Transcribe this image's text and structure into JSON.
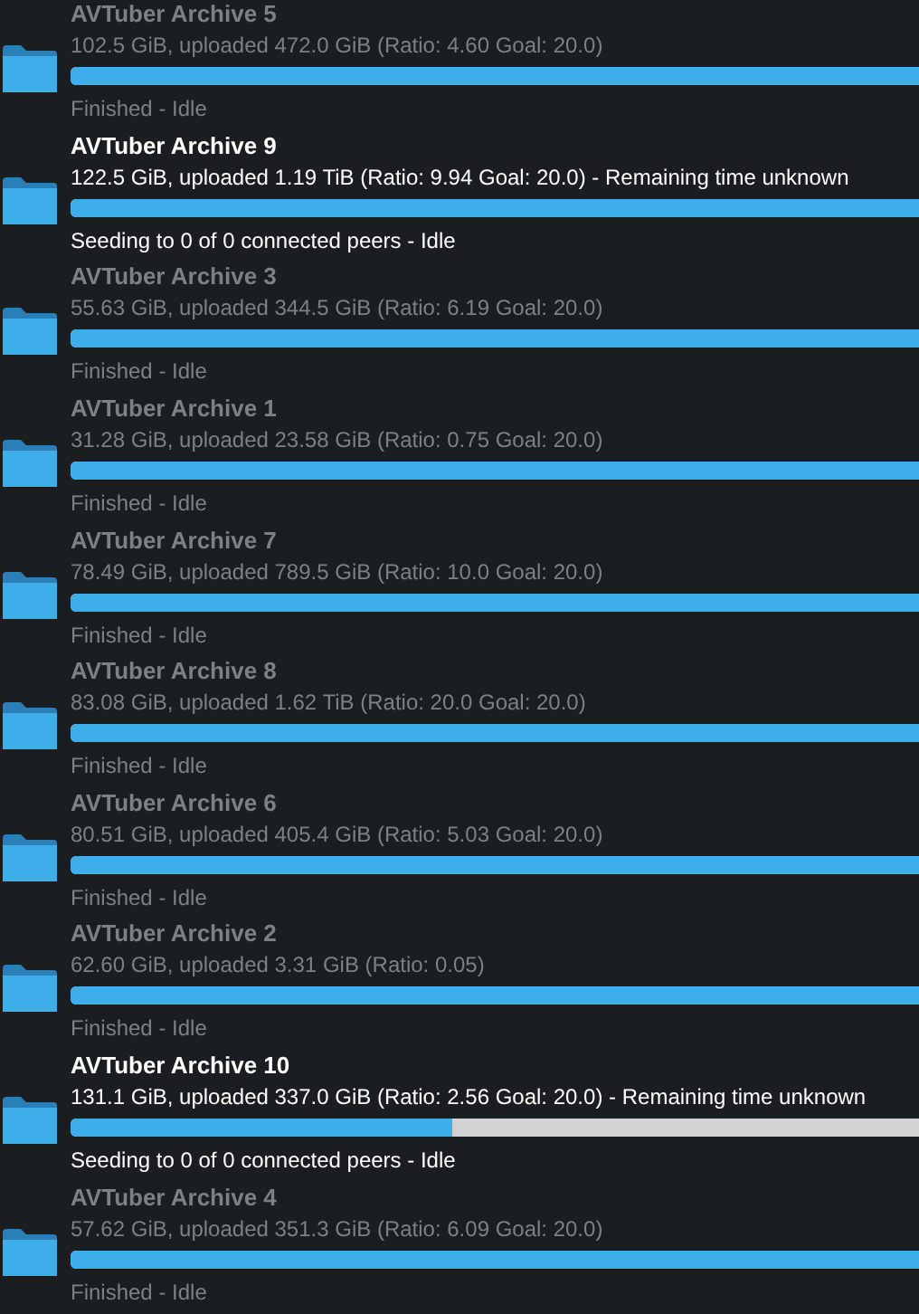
{
  "torrents": [
    {
      "name": "AVTuber Archive 5",
      "details": "102.5 GiB, uploaded 472.0 GiB (Ratio: 4.60 Goal: 20.0)",
      "level": 1,
      "status": "Finished - Idle",
      "active": false
    },
    {
      "name": "AVTuber Archive 9",
      "details": "122.5 GiB, uploaded 1.19 TiB (Ratio: 9.94 Goal: 20.0) - Remaining time unknown",
      "level": 1,
      "status": "Seeding to 0 of 0 connected peers - Idle",
      "active": true
    },
    {
      "name": "AVTuber Archive 3",
      "details": "55.63 GiB, uploaded 344.5 GiB (Ratio: 6.19 Goal: 20.0)",
      "level": 1,
      "status": "Finished - Idle",
      "active": false
    },
    {
      "name": "AVTuber Archive 1",
      "details": "31.28 GiB, uploaded 23.58 GiB (Ratio: 0.75 Goal: 20.0)",
      "level": 1,
      "status": "Finished - Idle",
      "active": false
    },
    {
      "name": "AVTuber Archive 7",
      "details": "78.49 GiB, uploaded 789.5 GiB (Ratio: 10.0 Goal: 20.0)",
      "level": 1,
      "status": "Finished - Idle",
      "active": false
    },
    {
      "name": "AVTuber Archive 8",
      "details": "83.08 GiB, uploaded 1.62 TiB (Ratio: 20.0 Goal: 20.0)",
      "level": 1,
      "status": "Finished - Idle",
      "active": false
    },
    {
      "name": "AVTuber Archive 6",
      "details": "80.51 GiB, uploaded 405.4 GiB (Ratio: 5.03 Goal: 20.0)",
      "level": 1,
      "status": "Finished - Idle",
      "active": false
    },
    {
      "name": "AVTuber Archive 2",
      "details": "62.60 GiB, uploaded 3.31 GiB (Ratio: 0.05)",
      "level": 1,
      "status": "Finished - Idle",
      "active": false
    },
    {
      "name": "AVTuber Archive 10",
      "details": "131.1 GiB, uploaded 337.0 GiB (Ratio: 2.56 Goal: 20.0) - Remaining time unknown",
      "level": 0.45,
      "status": "Seeding to 0 of 0 connected peers - Idle",
      "active": true
    },
    {
      "name": "AVTuber Archive 4",
      "details": "57.62 GiB, uploaded 351.3 GiB (Ratio: 6.09 Goal: 20.0)",
      "level": 1,
      "status": "Finished - Idle",
      "active": false
    }
  ]
}
